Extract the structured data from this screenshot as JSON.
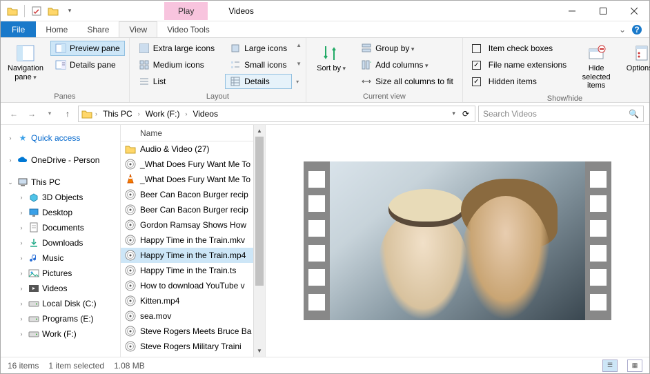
{
  "title": "Videos",
  "context_tab": "Play",
  "context_group": "Video Tools",
  "tabs": {
    "file": "File",
    "home": "Home",
    "share": "Share",
    "view": "View"
  },
  "ribbon": {
    "panes": {
      "label": "Panes",
      "navigation": "Navigation pane",
      "preview": "Preview pane",
      "details": "Details pane"
    },
    "layout": {
      "label": "Layout",
      "xl": "Extra large icons",
      "large": "Large icons",
      "medium": "Medium icons",
      "small": "Small icons",
      "list": "List",
      "details": "Details"
    },
    "current": {
      "label": "Current view",
      "sort": "Sort by",
      "group": "Group by",
      "addcols": "Add columns",
      "sizecols": "Size all columns to fit"
    },
    "showhide": {
      "label": "Show/hide",
      "checkboxes": "Item check boxes",
      "ext": "File name extensions",
      "hidden": "Hidden items",
      "hide": "Hide selected items",
      "options": "Options"
    }
  },
  "breadcrumb": [
    "This PC",
    "Work (F:)",
    "Videos"
  ],
  "search_placeholder": "Search Videos",
  "nav": {
    "quick": "Quick access",
    "onedrive": "OneDrive - Person",
    "thispc": "This PC",
    "items": [
      "3D Objects",
      "Desktop",
      "Documents",
      "Downloads",
      "Music",
      "Pictures",
      "Videos",
      "Local Disk (C:)",
      "Programs (E:)",
      "Work (F:)"
    ]
  },
  "column_header": "Name",
  "files": [
    {
      "name": "Audio & Video (27)",
      "type": "folder"
    },
    {
      "name": "_What Does Fury Want Me To",
      "type": "video"
    },
    {
      "name": "_What Does Fury Want Me To",
      "type": "vlc"
    },
    {
      "name": "Beer Can Bacon Burger recip",
      "type": "video"
    },
    {
      "name": "Beer Can Bacon Burger recip",
      "type": "video"
    },
    {
      "name": "Gordon Ramsay Shows How",
      "type": "video"
    },
    {
      "name": "Happy Time in the Train.mkv",
      "type": "video"
    },
    {
      "name": "Happy Time in the Train.mp4",
      "type": "video",
      "selected": true
    },
    {
      "name": "Happy Time in the Train.ts",
      "type": "video"
    },
    {
      "name": "How to download YouTube v",
      "type": "video"
    },
    {
      "name": "Kitten.mp4",
      "type": "video"
    },
    {
      "name": "sea.mov",
      "type": "video"
    },
    {
      "name": "Steve Rogers Meets Bruce Ba",
      "type": "video"
    },
    {
      "name": "Steve Rogers Military Traini",
      "type": "video"
    }
  ],
  "status": {
    "count": "16 items",
    "selected": "1 item selected",
    "size": "1.08 MB"
  }
}
